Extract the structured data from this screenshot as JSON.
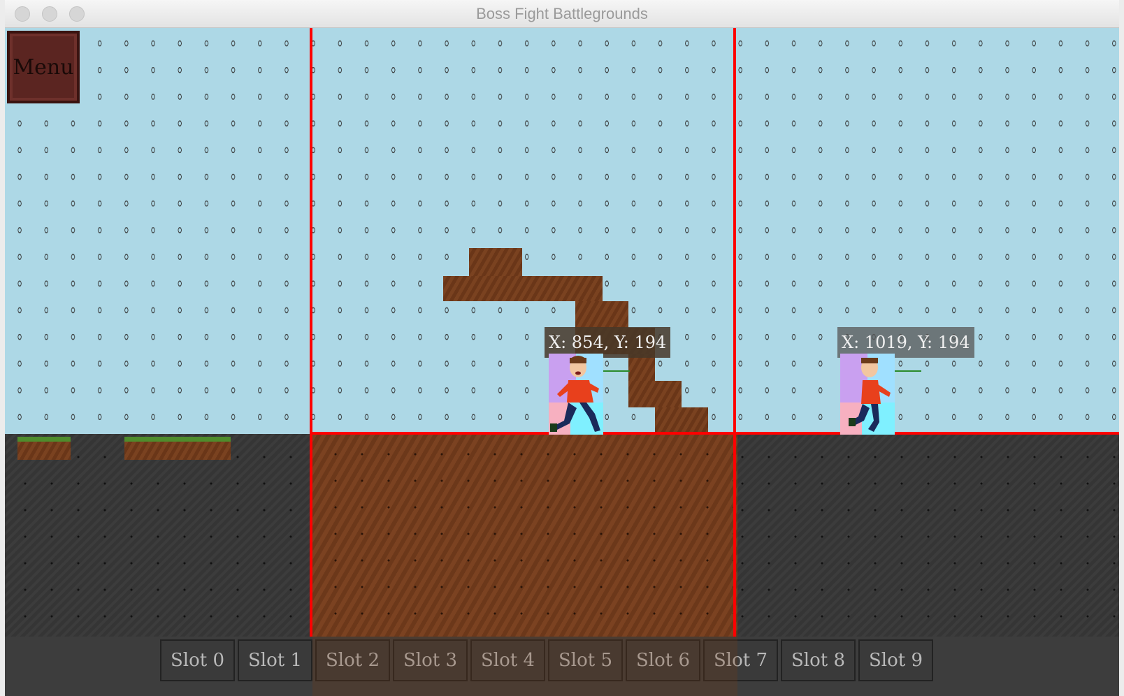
{
  "window": {
    "title": "Boss Fight Battlegrounds"
  },
  "menu": {
    "label": "Menu"
  },
  "players": [
    {
      "coord_label": "X: 854, Y: 194"
    },
    {
      "coord_label": "X: 1019, Y: 194"
    }
  ],
  "hotbar": {
    "slots": [
      "Slot 0",
      "Slot 1",
      "Slot 2",
      "Slot 3",
      "Slot 4",
      "Slot 5",
      "Slot 6",
      "Slot 7",
      "Slot 8",
      "Slot 9"
    ]
  },
  "colors": {
    "sky": "#add8e6",
    "boundary": "#ff0000",
    "dirt": "#7a4220",
    "stone": "#3c3c3c",
    "menu_button": "#5b2521"
  }
}
